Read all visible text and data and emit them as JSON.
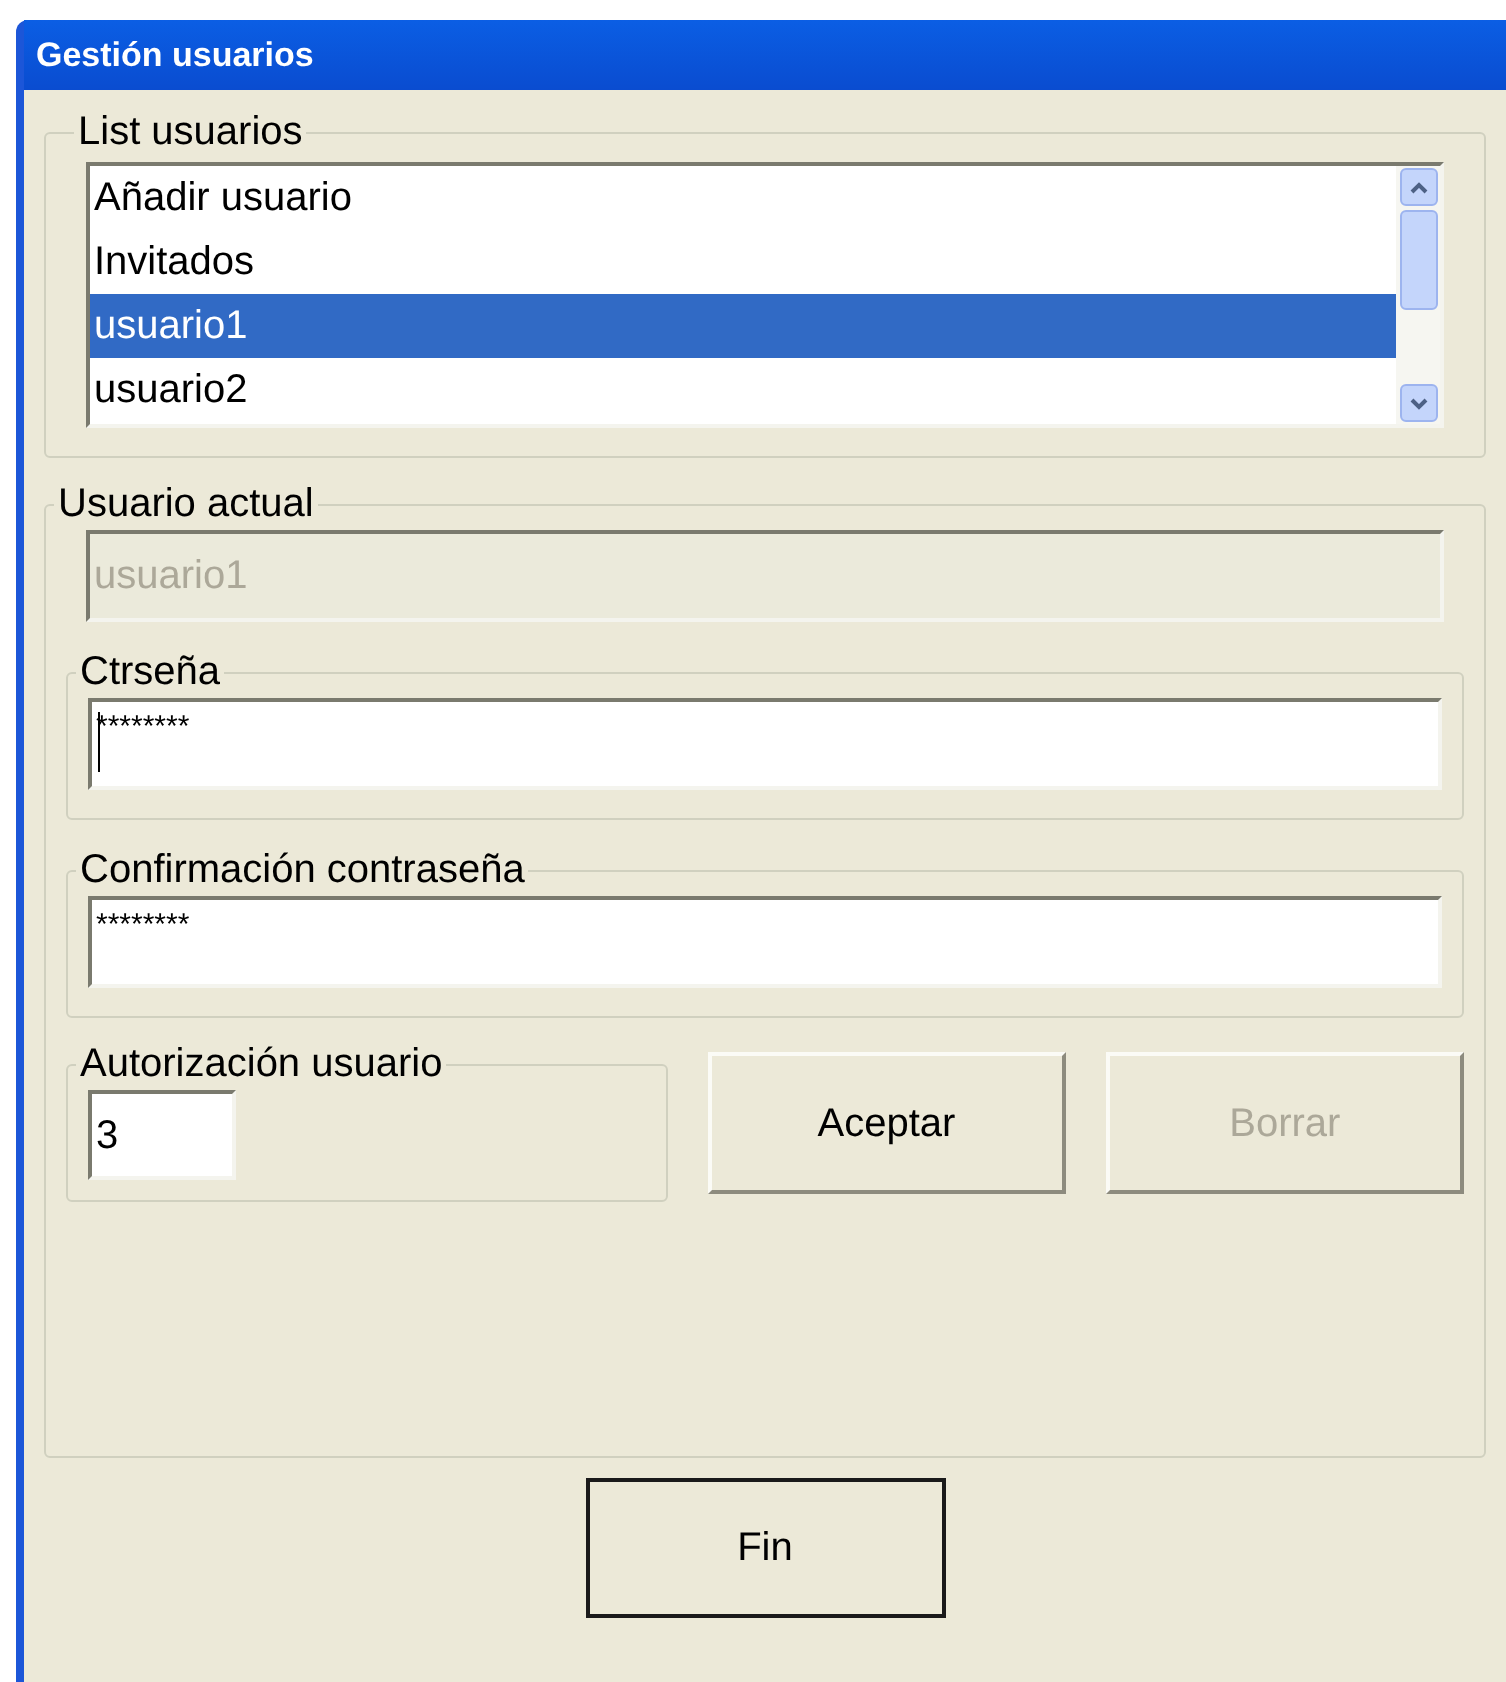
{
  "window": {
    "title": "Gestión usuarios"
  },
  "user_list": {
    "label": "List usuarios",
    "items": [
      {
        "label": "Añadir usuario",
        "selected": false
      },
      {
        "label": "Invitados",
        "selected": false
      },
      {
        "label": "usuario1",
        "selected": true
      },
      {
        "label": "usuario2",
        "selected": false
      }
    ]
  },
  "current_user": {
    "label": "Usuario actual",
    "value": "usuario1",
    "disabled": true,
    "password": {
      "label": "Ctrseña",
      "value": "********",
      "focused": true
    },
    "confirm": {
      "label": "Confirmación contraseña",
      "value": "********",
      "focused": false
    },
    "authorization": {
      "label": "Autorización usuario",
      "value": "3"
    },
    "buttons": [
      {
        "label": "Aceptar",
        "disabled": false
      },
      {
        "label": "Borrar",
        "disabled": true
      }
    ]
  },
  "finish_button": {
    "label": "Fin"
  }
}
